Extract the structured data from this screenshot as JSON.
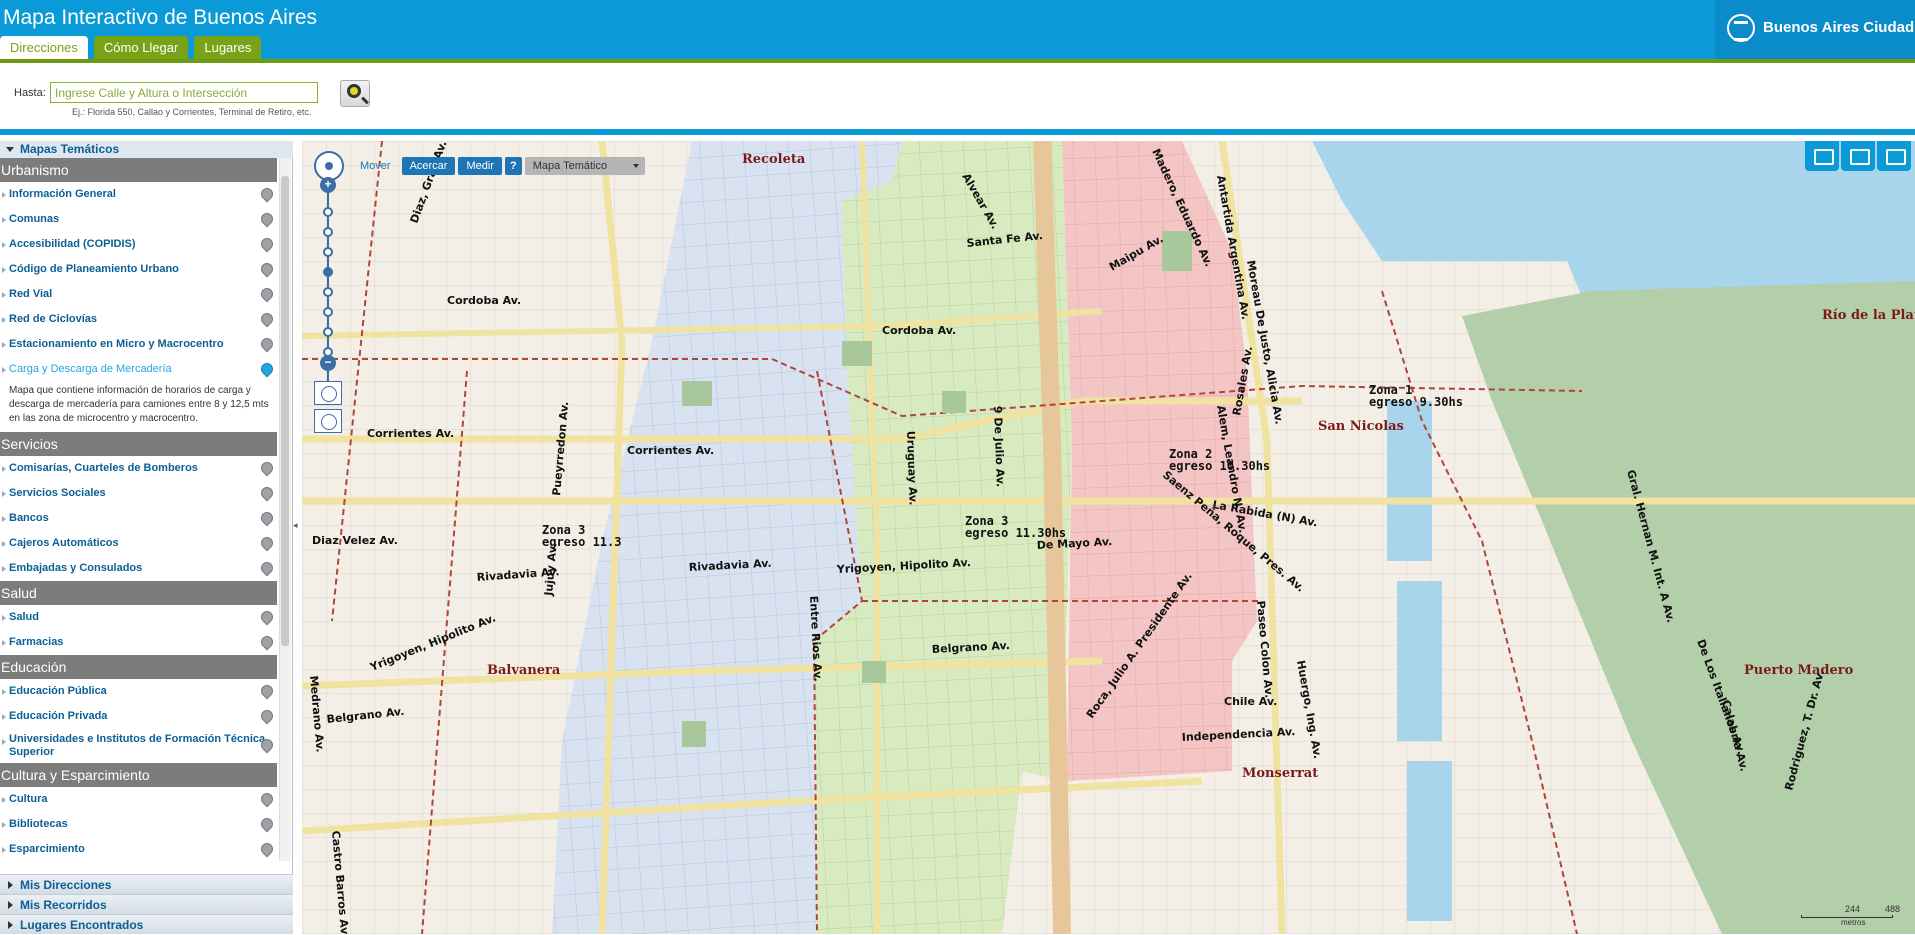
{
  "header": {
    "title": "Mapa Interactivo de Buenos Aires",
    "brand": "Buenos Aires Ciudad",
    "tabs": [
      {
        "label": "Direcciones",
        "active": true
      },
      {
        "label": "Cómo Llegar",
        "active": false
      },
      {
        "label": "Lugares",
        "active": false
      }
    ]
  },
  "search": {
    "label": "Hasta:",
    "placeholder": "Ingrese Calle y Altura o Intersección",
    "hint": "Ej.: Florida 550, Callao y Corrientes, Terminal de Retiro, etc."
  },
  "sidebar": {
    "section_title": "Mapas Temáticos",
    "categories": [
      {
        "name": "Urbanismo",
        "items": [
          {
            "label": "Información General"
          },
          {
            "label": "Comunas"
          },
          {
            "label": "Accesibilidad (COPIDIS)"
          },
          {
            "label": "Código de Planeamiento Urbano"
          },
          {
            "label": "Red Vial"
          },
          {
            "label": "Red de Ciclovías"
          },
          {
            "label": "Estacionamiento en Micro y Macrocentro"
          },
          {
            "label": "Carga y Descarga de Mercadería",
            "active": true,
            "description": "Mapa que contiene información de horarios de carga y descarga de mercadería para camiones entre 8 y 12,5 mts en las zona de microcentro y macrocentro."
          }
        ]
      },
      {
        "name": "Servicios",
        "items": [
          {
            "label": "Comisarías, Cuarteles de Bomberos"
          },
          {
            "label": "Servicios Sociales"
          },
          {
            "label": "Bancos"
          },
          {
            "label": "Cajeros Automáticos"
          },
          {
            "label": "Embajadas y Consulados"
          }
        ]
      },
      {
        "name": "Salud",
        "items": [
          {
            "label": "Salud"
          },
          {
            "label": "Farmacias"
          }
        ]
      },
      {
        "name": "Educación",
        "items": [
          {
            "label": "Educación Pública"
          },
          {
            "label": "Educación Privada"
          },
          {
            "label": "Universidades e Institutos de Formación Técnica Superior",
            "two_lines": true
          }
        ]
      },
      {
        "name": "Cultura y Esparcimiento",
        "items": [
          {
            "label": "Cultura"
          },
          {
            "label": "Bibliotecas"
          },
          {
            "label": "Esparcimiento"
          }
        ]
      }
    ],
    "accordions": [
      "Mis Direcciones",
      "Mis Recorridos",
      "Lugares Encontrados"
    ]
  },
  "map_tools": {
    "mover": "Mover",
    "acercar": "Acercar",
    "medir": "Medir",
    "help": "?",
    "thematic_select": "Mapa Temático",
    "zoom_in": "+",
    "zoom_out": "−"
  },
  "map": {
    "places": [
      "Recoleta",
      "San Nicolas",
      "Balvanera",
      "Monserrat",
      "Puerto Madero",
      "Río de la Plata"
    ],
    "zones": [
      {
        "name": "Zona 1",
        "schedule": "egreso 9.30hs",
        "color": "#f4c5c5"
      },
      {
        "name": "Zona 2",
        "schedule": "egreso 10.30hs",
        "color": "#d8ebc0"
      },
      {
        "name": "Zona 3",
        "schedule": "egreso 11.30hs",
        "color": "#d6e0f0"
      },
      {
        "name": "Zona 3",
        "schedule": "egreso 11.3",
        "color": "#d6e0f0"
      }
    ],
    "streets": [
      "Santa Fe Av.",
      "Cordoba Av.",
      "Corrientes Av.",
      "Rivadavia Av.",
      "De Mayo Av.",
      "Belgrano Av.",
      "Independencia Av.",
      "Chile Av.",
      "Diaz Velez Av.",
      "Yrigoyen, Hipolito Av.",
      "Pueyrredon Av.",
      "Jujuy Av.",
      "Entre Rios Av.",
      "9 De Julio Av.",
      "Uruguay Av.",
      "Alvear Av.",
      "Maipu Av.",
      "Madero, Eduardo Av.",
      "Antartida Argentina Av.",
      "Moreau De Justo, Alicia Av.",
      "Alem, Leandro N. Av.",
      "Rosales Av.",
      "La Rabida (N) Av.",
      "Paseo Colon Av.",
      "Huergo, Ing. Av.",
      "Saenz Peña, Roque, Pres. Av.",
      "Roca, Julio A. Presidente Av.",
      "Medrano Av.",
      "Castro Barros Av.",
      "Diaz, Gral. Av.",
      "Gral. Hernan M. Int. A Av.",
      "De Los Italianos Av.",
      "Calabria Av.",
      "Rodriguez, T. Dr. Av."
    ],
    "scale": {
      "mid": "244",
      "max": "488",
      "unit": "metros"
    },
    "colors": {
      "zone1": "#f4c5c5",
      "zone2": "#d8ebc0",
      "zone3": "#d6e0f0",
      "water": "#a8d4ec",
      "park": "#b3cfa9",
      "accent": "#0b9ad8"
    }
  }
}
